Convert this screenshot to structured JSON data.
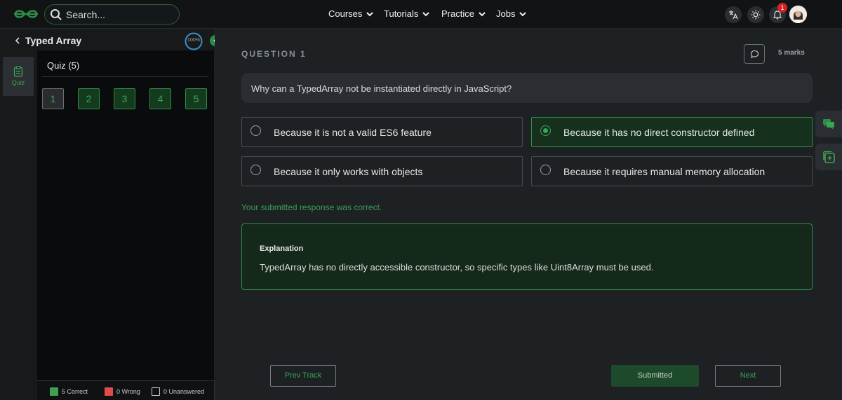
{
  "header": {
    "search_placeholder": "Search...",
    "nav": [
      {
        "label": "Courses"
      },
      {
        "label": "Tutorials"
      },
      {
        "label": "Practice"
      },
      {
        "label": "Jobs"
      }
    ],
    "notification_count": "1"
  },
  "sidebar": {
    "topic_title": "Typed Array",
    "progress_label": "100%",
    "rail_tab_label": "Quiz",
    "quiz_heading": "Quiz (5)",
    "questions": [
      "1",
      "2",
      "3",
      "4",
      "5"
    ],
    "legend": {
      "correct": "5 Correct",
      "wrong": "0 Wrong",
      "unanswered": "0 Unanswered"
    }
  },
  "question": {
    "number_label": "QUESTION 1",
    "marks": "5 marks",
    "text": "Why can a TypedArray not be instantiated directly in JavaScript?",
    "options": [
      {
        "text": "Because it is not a valid ES6 feature",
        "selected": false
      },
      {
        "text": "Because it has no direct constructor defined",
        "selected": true
      },
      {
        "text": "Because it only works with objects",
        "selected": false
      },
      {
        "text": "Because it requires manual memory allocation",
        "selected": false
      }
    ],
    "status_text": "Your submitted response was correct.",
    "explanation_title": "Explanation",
    "explanation_text": "TypedArray has no directly accessible constructor, so specific types like Uint8Array must be used."
  },
  "footer": {
    "prev_label": "Prev Track",
    "submitted_label": "Submitted",
    "next_label": "Next"
  },
  "colors": {
    "accent": "#2f8d46",
    "correct": "#3ea153",
    "wrong": "#e04b4b",
    "background": "#1e2124"
  }
}
